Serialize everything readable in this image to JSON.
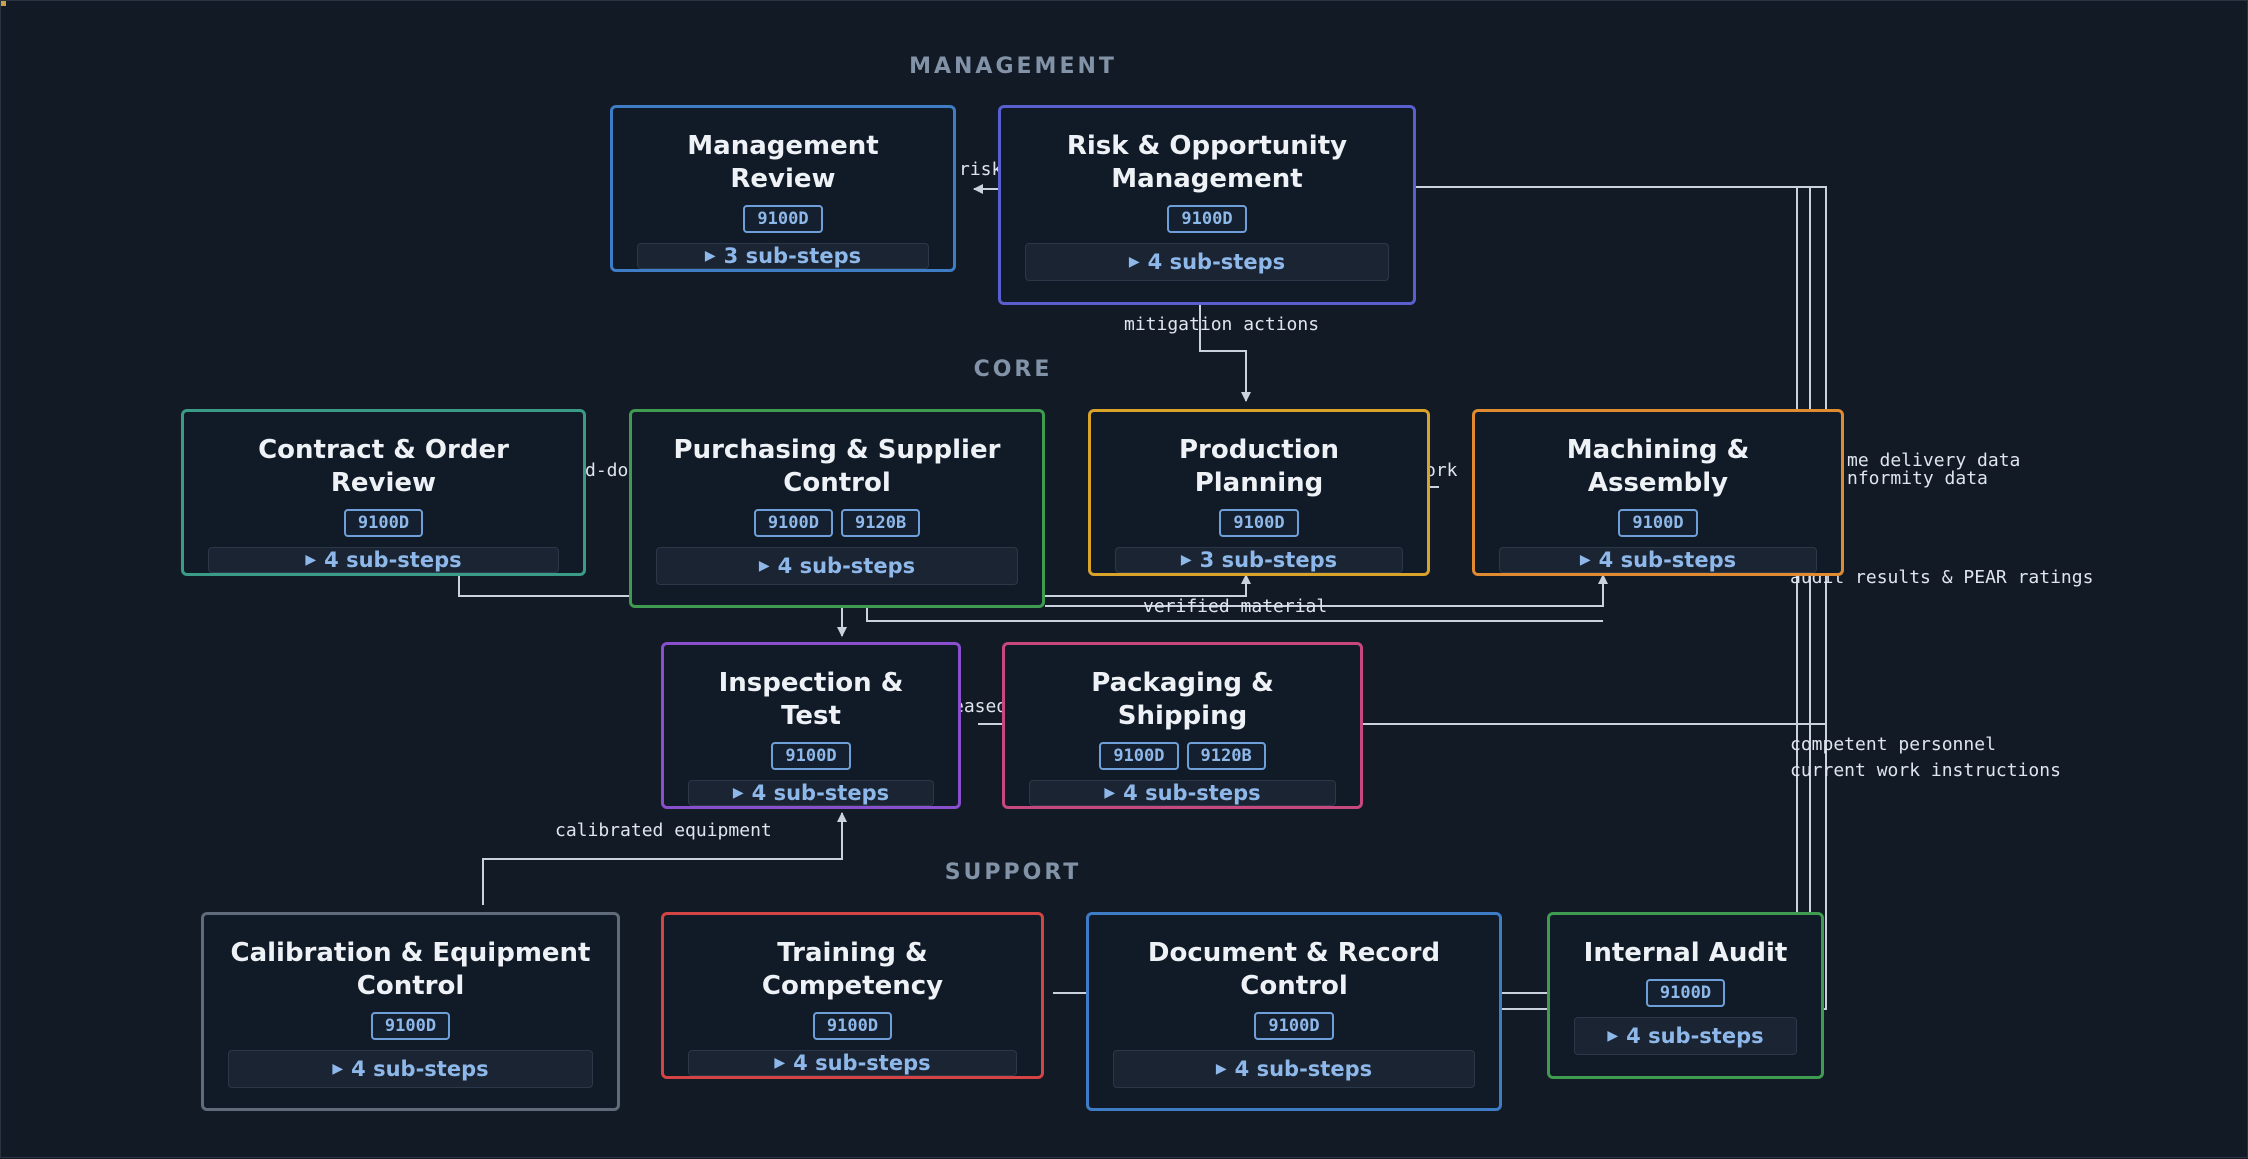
{
  "lanes": {
    "management": "MANAGEMENT",
    "core": "CORE",
    "support": "SUPPORT"
  },
  "nodes": {
    "management_review": {
      "title": "Management Review",
      "badges": [
        "9100D"
      ],
      "substeps": "3 sub-steps",
      "color": "#3f7cc6"
    },
    "risk": {
      "title": "Risk & Opportunity Management",
      "badges": [
        "9100D"
      ],
      "substeps": "4 sub-steps",
      "color": "#5a5fcf"
    },
    "contract": {
      "title": "Contract & Order Review",
      "badges": [
        "9100D"
      ],
      "substeps": "4 sub-steps",
      "color": "#3a9b86"
    },
    "purchasing": {
      "title": "Purchasing & Supplier Control",
      "badges": [
        "9100D",
        "9120B"
      ],
      "substeps": "4 sub-steps",
      "color": "#3f9b50"
    },
    "production": {
      "title": "Production Planning",
      "badges": [
        "9100D"
      ],
      "substeps": "3 sub-steps",
      "color": "#d9a32a"
    },
    "machining": {
      "title": "Machining & Assembly",
      "badges": [
        "9100D"
      ],
      "substeps": "4 sub-steps",
      "color": "#e08a32"
    },
    "inspection": {
      "title": "Inspection & Test",
      "badges": [
        "9100D"
      ],
      "substeps": "4 sub-steps",
      "color": "#8a4fcc"
    },
    "packaging": {
      "title": "Packaging & Shipping",
      "badges": [
        "9100D",
        "9120B"
      ],
      "substeps": "4 sub-steps",
      "color": "#c7487e"
    },
    "calibration": {
      "title": "Calibration & Equipment Control",
      "badges": [
        "9100D"
      ],
      "substeps": "4 sub-steps",
      "color": "#5f6b7b"
    },
    "training": {
      "title": "Training & Competency",
      "badges": [
        "9100D"
      ],
      "substeps": "4 sub-steps",
      "color": "#d44444"
    },
    "documents": {
      "title": "Document & Record Control",
      "badges": [
        "9100D"
      ],
      "substeps": "4 sub-steps",
      "color": "#3f7cc6"
    },
    "audit": {
      "title": "Internal Audit",
      "badges": [
        "9100D"
      ],
      "substeps": "4 sub-steps",
      "color": "#3f9b50"
    }
  },
  "edge_labels": {
    "risk": "risk",
    "mitigation": "mitigation actions",
    "flowdown": "d-do",
    "work": "ork",
    "ontime": "me delivery data",
    "conformity": "nformity data",
    "verified": "verified material",
    "released": "eased",
    "audit_results": "audit results & PEAR ratings",
    "competent": "competent personnel",
    "instructions": "current work instructions",
    "calibrated": "calibrated equipment"
  },
  "icons": {
    "substep": "triangle-right-icon",
    "arrowhead": "arrowhead-icon"
  }
}
